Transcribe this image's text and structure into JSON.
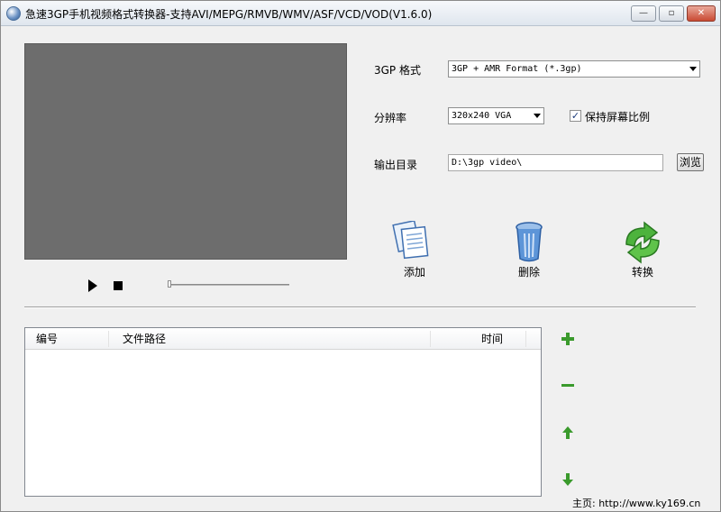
{
  "window": {
    "title": "急速3GP手机视频格式转换器-支持AVI/MEPG/RMVB/WMV/ASF/VCD/VOD(V1.6.0)",
    "min_label": "—",
    "max_label": "▫",
    "close_label": "✕"
  },
  "format": {
    "label": "3GP 格式",
    "value": "3GP + AMR Format (*.3gp)"
  },
  "resolution": {
    "label": "分辨率",
    "value": "320x240 VGA",
    "keep_ratio_label": "保持屏幕比例",
    "keep_ratio_checked": true
  },
  "output": {
    "label": "输出目录",
    "value": "D:\\3gp video\\",
    "browse_label": "浏览"
  },
  "actions": {
    "add_label": "添加",
    "delete_label": "删除",
    "convert_label": "转换"
  },
  "table": {
    "columns": [
      "编号",
      "文件路径",
      "时间"
    ],
    "rows": []
  },
  "footer": {
    "homepage": "主页: http://www.ky169.cn"
  },
  "icons": {
    "app": "app-globe-icon",
    "play": "play-icon",
    "stop": "stop-icon",
    "add": "add-documents-icon",
    "delete": "trash-bin-icon",
    "convert": "convert-arrows-icon",
    "plus": "plus-icon",
    "minus": "minus-icon",
    "up": "arrow-up-icon",
    "down": "arrow-down-icon"
  }
}
